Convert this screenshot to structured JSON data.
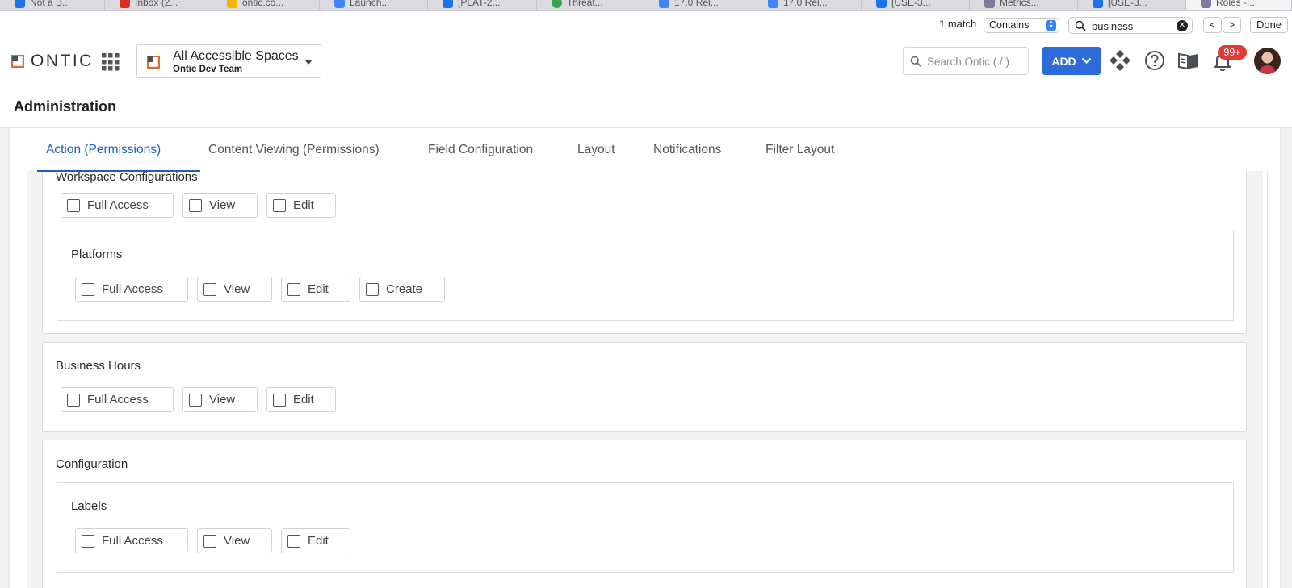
{
  "browser_tabs": [
    {
      "label": "Not a B...",
      "color": "#1a73e8"
    },
    {
      "label": "Inbox (2...",
      "color": "#d93025"
    },
    {
      "label": "ontic.co...",
      "color": "#f4b400"
    },
    {
      "label": "Launch...",
      "color": "#4285f4"
    },
    {
      "label": "[PLAT-2...",
      "color": "#1a73e8"
    },
    {
      "label": "Threat...",
      "color": "#34a853"
    },
    {
      "label": "17.0 Rel...",
      "color": "#4285f4"
    },
    {
      "label": "17.0 Rel...",
      "color": "#4285f4"
    },
    {
      "label": "[USE-3...",
      "color": "#1a73e8"
    },
    {
      "label": "Metrics...",
      "color": "#7b7b9a"
    },
    {
      "label": "[USE-3...",
      "color": "#1a73e8"
    },
    {
      "label": "Roles -...",
      "color": "#7b7b9a"
    }
  ],
  "findbar": {
    "match_count": "1 match",
    "mode": "Contains",
    "query": "business",
    "prev": "<",
    "next": ">",
    "done": "Done"
  },
  "header": {
    "logo_text": "ONTIC",
    "space_title": "All Accessible Spaces",
    "space_subtitle": "Ontic Dev Team",
    "search_placeholder": "Search Ontic ( / )",
    "add_label": "ADD",
    "notification_count": "99+",
    "accent": "#2f6bd8"
  },
  "page": {
    "title": "Administration"
  },
  "tabs": [
    {
      "label": "Action (Permissions)",
      "active": true
    },
    {
      "label": "Content Viewing (Permissions)",
      "active": false
    },
    {
      "label": "Field Configuration",
      "active": false
    },
    {
      "label": "Layout",
      "active": false
    },
    {
      "label": "Notifications",
      "active": false
    },
    {
      "label": "Filter Layout",
      "active": false
    }
  ],
  "sections": {
    "workspace": {
      "title": "Workspace Configurations",
      "options": [
        "Full Access",
        "View",
        "Edit"
      ],
      "platforms": {
        "title": "Platforms",
        "options": [
          "Full Access",
          "View",
          "Edit",
          "Create"
        ]
      }
    },
    "business_hours": {
      "title": "Business Hours",
      "options": [
        "Full Access",
        "View",
        "Edit"
      ]
    },
    "configuration": {
      "title": "Configuration",
      "labels": {
        "title": "Labels",
        "options": [
          "Full Access",
          "View",
          "Edit"
        ]
      }
    }
  }
}
